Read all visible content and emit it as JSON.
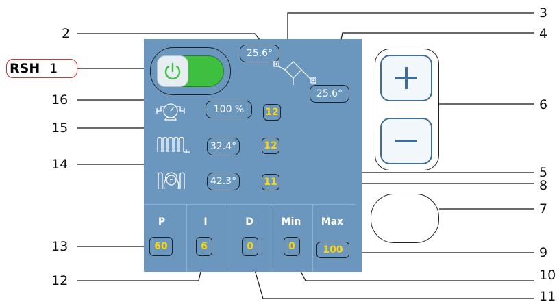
{
  "callouts": {
    "n1": "1",
    "n2": "2",
    "n3": "3",
    "n4": "4",
    "n5": "5",
    "n6": "6",
    "n7": "7",
    "n8": "8",
    "n9": "9",
    "n10": "10",
    "n11": "11",
    "n12": "12",
    "n13": "13",
    "n14": "14",
    "n15": "15",
    "n16": "16"
  },
  "tag": {
    "label": "RSH"
  },
  "temps": {
    "top": "25.6°",
    "right": "25.6°"
  },
  "rows": {
    "pump": {
      "percent": "100 %",
      "badge": "12"
    },
    "radiator": {
      "temp": "32.4°",
      "badge": "12"
    },
    "boiler": {
      "temp": "42.3°",
      "badge": "11"
    }
  },
  "pid": {
    "headers": [
      "P",
      "I",
      "D",
      "Min",
      "Max"
    ],
    "values": [
      "60",
      "6",
      "0",
      "0",
      "100"
    ]
  },
  "icons": {
    "power": "power-icon",
    "pump": "pump-icon",
    "radiator": "radiator-icon",
    "boiler": "boiler-thermometer-icon",
    "valve": "valve-icon",
    "plus": "plus-icon",
    "minus": "minus-icon",
    "back": "back-arrow-icon"
  },
  "colors": {
    "panel": "#6b97bf",
    "badge_text": "#ffd400",
    "toggle_on": "#3fbf3f"
  }
}
